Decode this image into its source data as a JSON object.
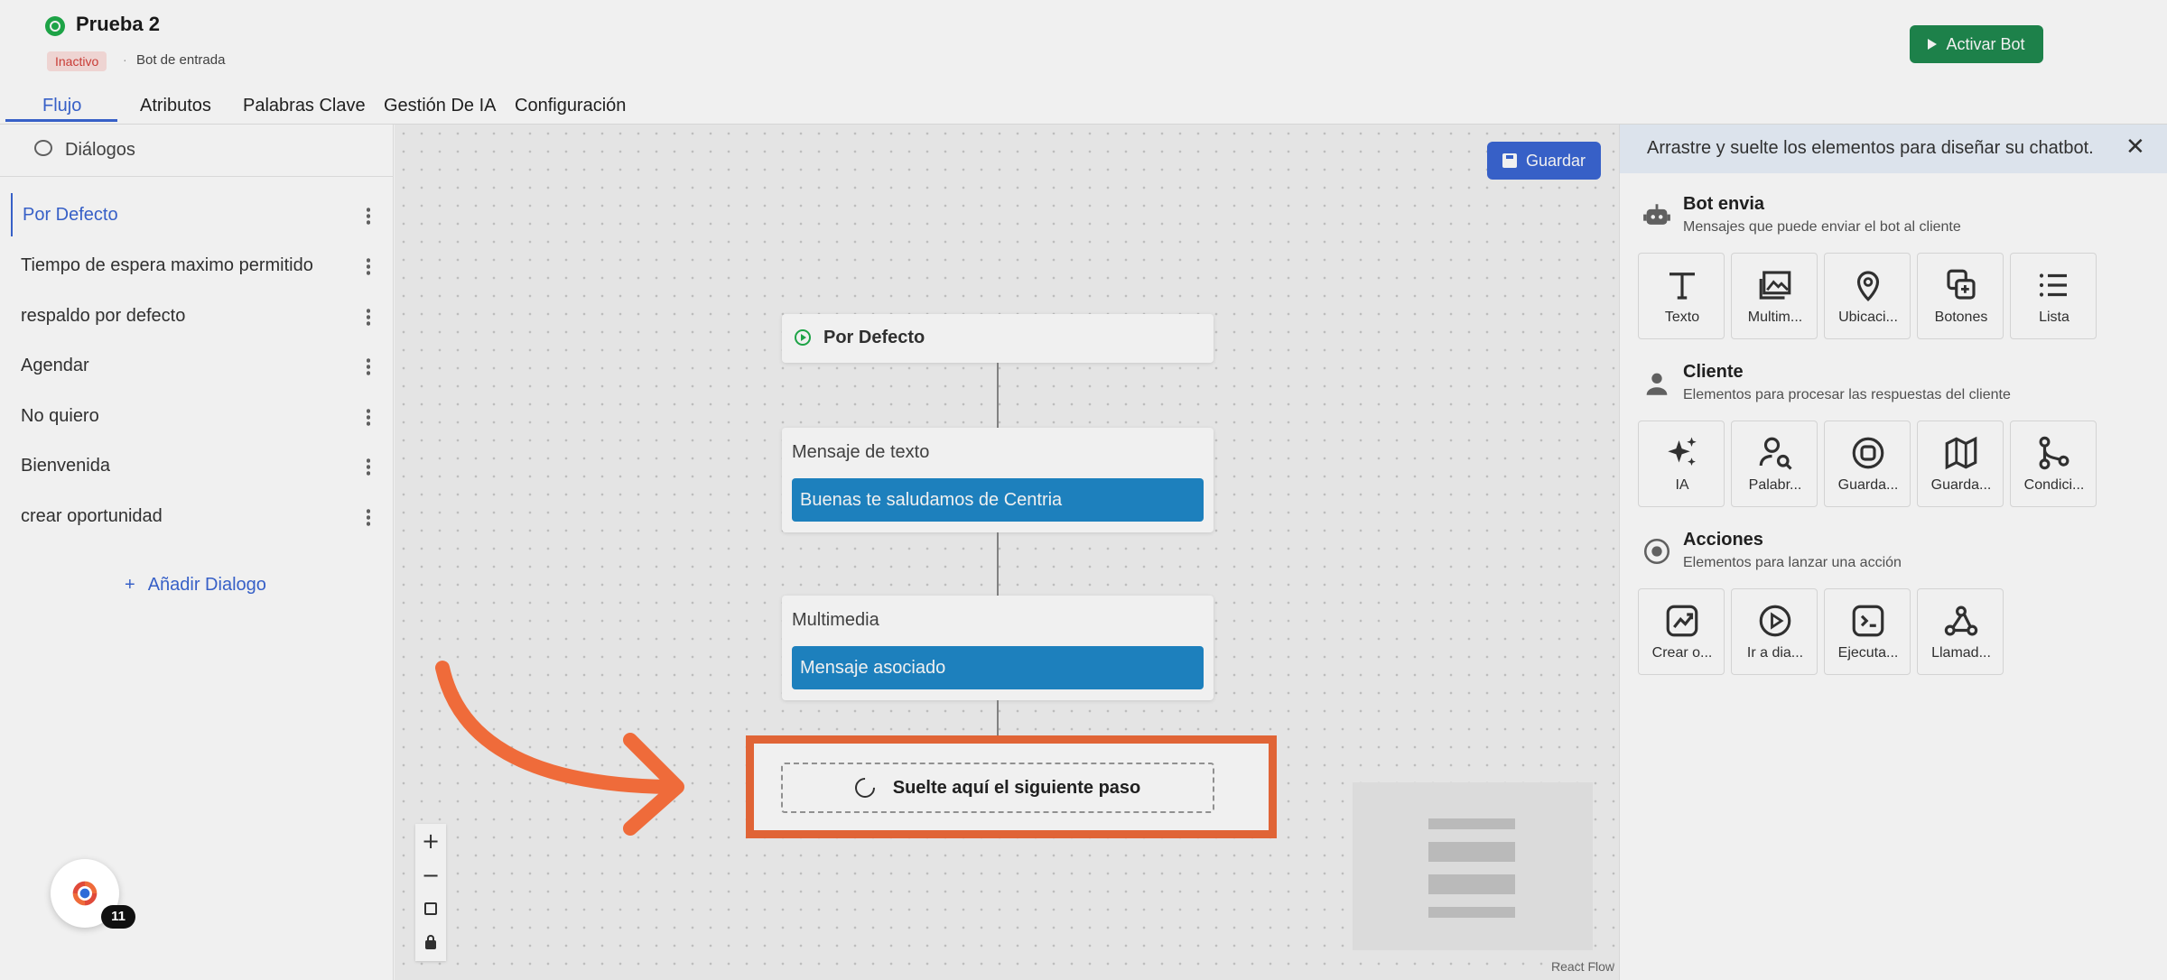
{
  "header": {
    "bot_name": "Prueba 2",
    "status": "Inactivo",
    "separator": "·",
    "bot_type": "Bot de entrada",
    "activate_label": "Activar Bot"
  },
  "tabs": [
    {
      "label": "Flujo",
      "active": true
    },
    {
      "label": "Atributos"
    },
    {
      "label": "Palabras Clave"
    },
    {
      "label": "Gestión De IA"
    },
    {
      "label": "Configuración"
    }
  ],
  "sidebar": {
    "title": "Diálogos",
    "items": [
      {
        "label": "Por Defecto",
        "active": true
      },
      {
        "label": "Tiempo de espera maximo permitido"
      },
      {
        "label": "respaldo por defecto"
      },
      {
        "label": "Agendar"
      },
      {
        "label": "No quiero"
      },
      {
        "label": "Bienvenida"
      },
      {
        "label": "crear oportunidad"
      }
    ],
    "add_label": "Añadir Dialogo",
    "add_icon": "+"
  },
  "canvas": {
    "save_label": "Guardar",
    "start_node_title": "Por Defecto",
    "text_node": {
      "label": "Mensaje de texto",
      "body": "Buenas te saludamos de Centria"
    },
    "media_node": {
      "label": "Multimedia",
      "body": "Mensaje asociado"
    },
    "drop_label": "Suelte aquí el siguiente paso",
    "zoom_in": "+",
    "zoom_out": "−",
    "attribution": "React Flow"
  },
  "panel": {
    "hint": "Arrastre y suelte los elementos para diseñar su chatbot.",
    "close": "✕",
    "sections": [
      {
        "title": "Bot envia",
        "description": "Mensajes que puede enviar el bot al cliente",
        "icon": "robot-icon",
        "tools": [
          {
            "label": "Texto",
            "icon": "text-icon"
          },
          {
            "label": "Multim...",
            "icon": "gallery-icon"
          },
          {
            "label": "Ubicaci...",
            "icon": "location-icon"
          },
          {
            "label": "Botones",
            "icon": "buttons-icon"
          },
          {
            "label": "Lista",
            "icon": "list-icon"
          }
        ]
      },
      {
        "title": "Cliente",
        "description": "Elementos para procesar las respuestas del cliente",
        "icon": "person-icon",
        "tools": [
          {
            "label": "IA",
            "icon": "sparkles-icon"
          },
          {
            "label": "Palabr...",
            "icon": "user-search-icon"
          },
          {
            "label": "Guarda...",
            "icon": "badge-icon"
          },
          {
            "label": "Guarda...",
            "icon": "map-icon"
          },
          {
            "label": "Condici...",
            "icon": "branch-icon"
          }
        ]
      },
      {
        "title": "Acciones",
        "description": "Elementos para lanzar una acción",
        "icon": "target-icon",
        "tools": [
          {
            "label": "Crear o...",
            "icon": "chart-up-icon"
          },
          {
            "label": "Ir a dia...",
            "icon": "play-circle-icon"
          },
          {
            "label": "Ejecuta...",
            "icon": "terminal-icon"
          },
          {
            "label": "Llamad...",
            "icon": "webhook-icon"
          }
        ]
      }
    ]
  },
  "assistant": {
    "badge": "11"
  },
  "colors": {
    "primary": "#3b66d4",
    "success": "#1f8a4f",
    "node_body": "#1f89c9",
    "highlight": "#ef6b3a"
  }
}
